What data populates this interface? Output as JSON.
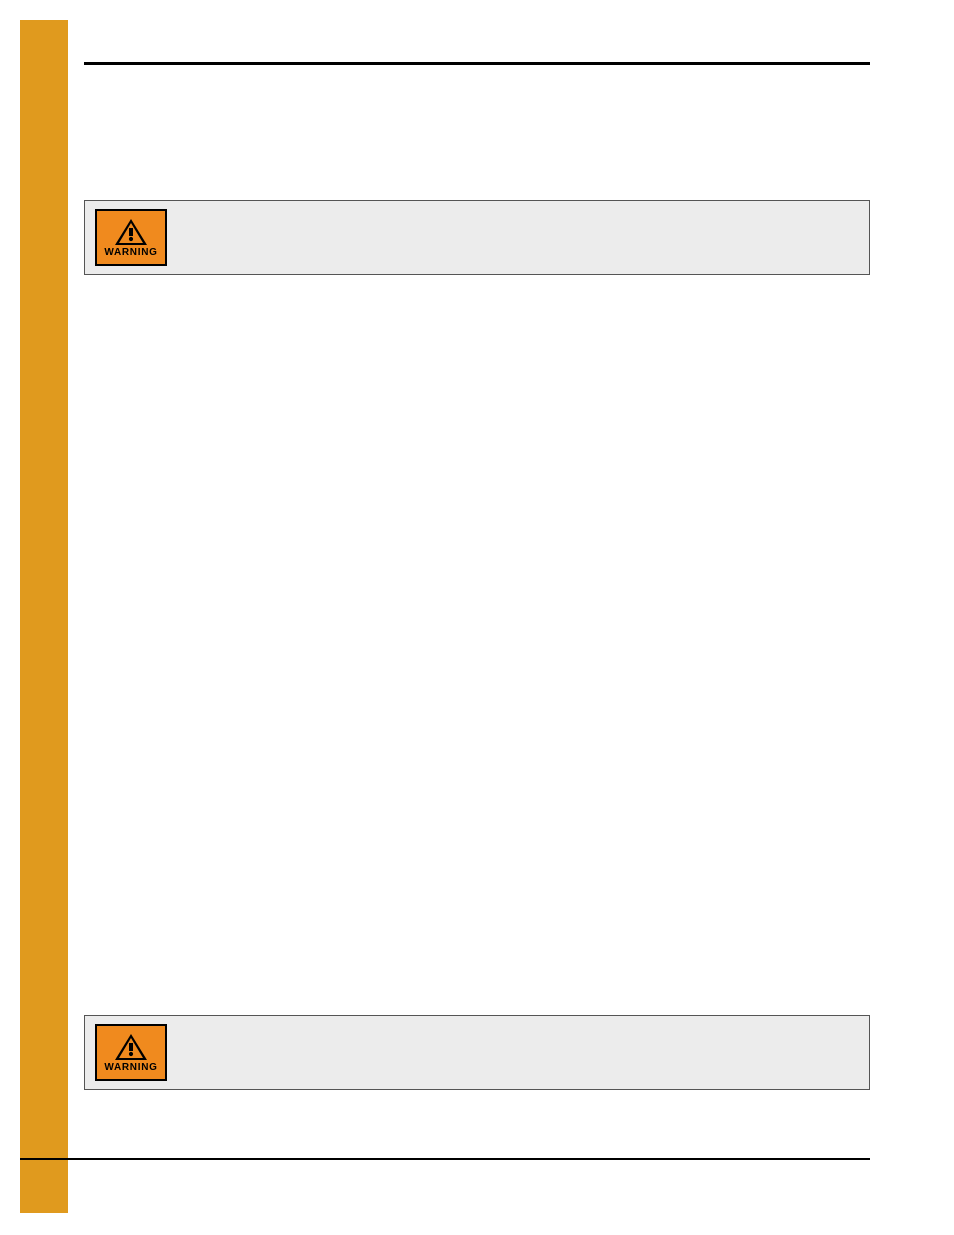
{
  "colors": {
    "stripe": "#e09a1e",
    "warning_bg": "#f08a1e",
    "panel_bg": "#ececec"
  },
  "warnings": [
    {
      "label": "WARNING",
      "text": ""
    },
    {
      "label": "WARNING",
      "text": ""
    }
  ],
  "page_number": ""
}
